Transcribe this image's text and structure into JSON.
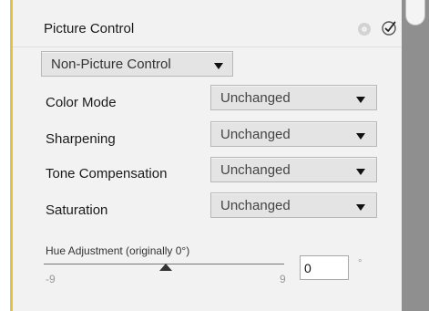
{
  "section": {
    "title": "Picture Control",
    "reset_icon": "reset-icon",
    "apply_icon": "checkmark-icon"
  },
  "picture_control_select": {
    "value": "Non-Picture Control"
  },
  "rows": [
    {
      "label": "Color Mode",
      "value": "Unchanged"
    },
    {
      "label": "Sharpening",
      "value": "Unchanged"
    },
    {
      "label": "Tone Compensation",
      "value": "Unchanged"
    },
    {
      "label": "Saturation",
      "value": "Unchanged"
    }
  ],
  "hue": {
    "label": "Hue Adjustment (originally 0°)",
    "min": "-9",
    "max": "9",
    "value": "0",
    "unit": "°"
  },
  "colors": {
    "accent": "#e0c44a",
    "panel_bg": "#f2f2f2",
    "scrollbar": "#8f8f8f"
  }
}
